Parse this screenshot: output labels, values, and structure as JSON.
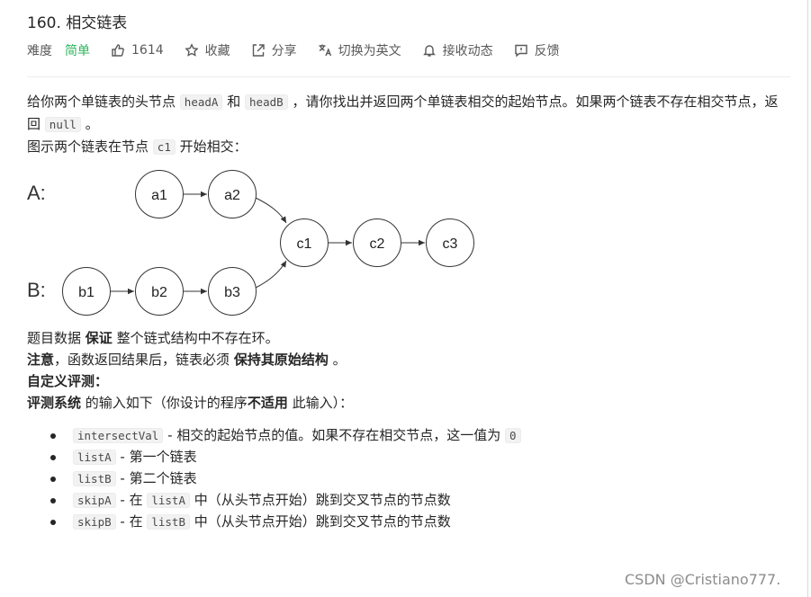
{
  "problem": {
    "title": "160. 相交链表"
  },
  "meta": {
    "difficulty_label": "难度",
    "difficulty_value": "简单",
    "difficulty_color": "#2db55d",
    "likes": "1614",
    "favorite": "收藏",
    "share": "分享",
    "switch_lang": "切换为英文",
    "notify": "接收动态",
    "feedback": "反馈"
  },
  "description": {
    "p1_a": "给你两个单链表的头节点",
    "p1_code1": "headA",
    "p1_b": "和",
    "p1_code2": "headB",
    "p1_c": "，请你找出并返回两个单链表相交的起始节点。如果两个链表不存在相交节点，返回",
    "p1_code3": "null",
    "p1_d": "。",
    "p2_a": "图示两个链表在节点",
    "p2_code": "c1",
    "p2_b": "开始相交："
  },
  "diagram": {
    "label_a": "A:",
    "label_b": "B:",
    "nodes": {
      "a1": "a1",
      "a2": "a2",
      "b1": "b1",
      "b2": "b2",
      "b3": "b3",
      "c1": "c1",
      "c2": "c2",
      "c3": "c3"
    }
  },
  "notes": {
    "p3_a": "题目数据",
    "p3_b": "保证",
    "p3_c": "整个链式结构中不存在环。",
    "p4_a": "注意",
    "p4_b": "，函数返回结果后，链表必须",
    "p4_c": "保持其原始结构",
    "p4_d": "。",
    "p5": "自定义评测：",
    "p6_a": "评测系统",
    "p6_b": "的输入如下（你设计的程序",
    "p6_c": "不适用",
    "p6_d": "此输入）："
  },
  "params": [
    {
      "code": "intersectVal",
      "text_a": " - 相交的起始节点的值。如果不存在相交节点，这一值为 ",
      "code2": "0",
      "text_b": ""
    },
    {
      "code": "listA",
      "text_a": " - 第一个链表",
      "code2": "",
      "text_b": ""
    },
    {
      "code": "listB",
      "text_a": " - 第二个链表",
      "code2": "",
      "text_b": ""
    },
    {
      "code": "skipA",
      "text_a": " - 在 ",
      "code2": "listA",
      "text_b": " 中（从头节点开始）跳到交叉节点的节点数"
    },
    {
      "code": "skipB",
      "text_a": " - 在 ",
      "code2": "listB",
      "text_b": " 中（从头节点开始）跳到交叉节点的节点数"
    }
  ],
  "watermark": "CSDN @Cristiano777."
}
